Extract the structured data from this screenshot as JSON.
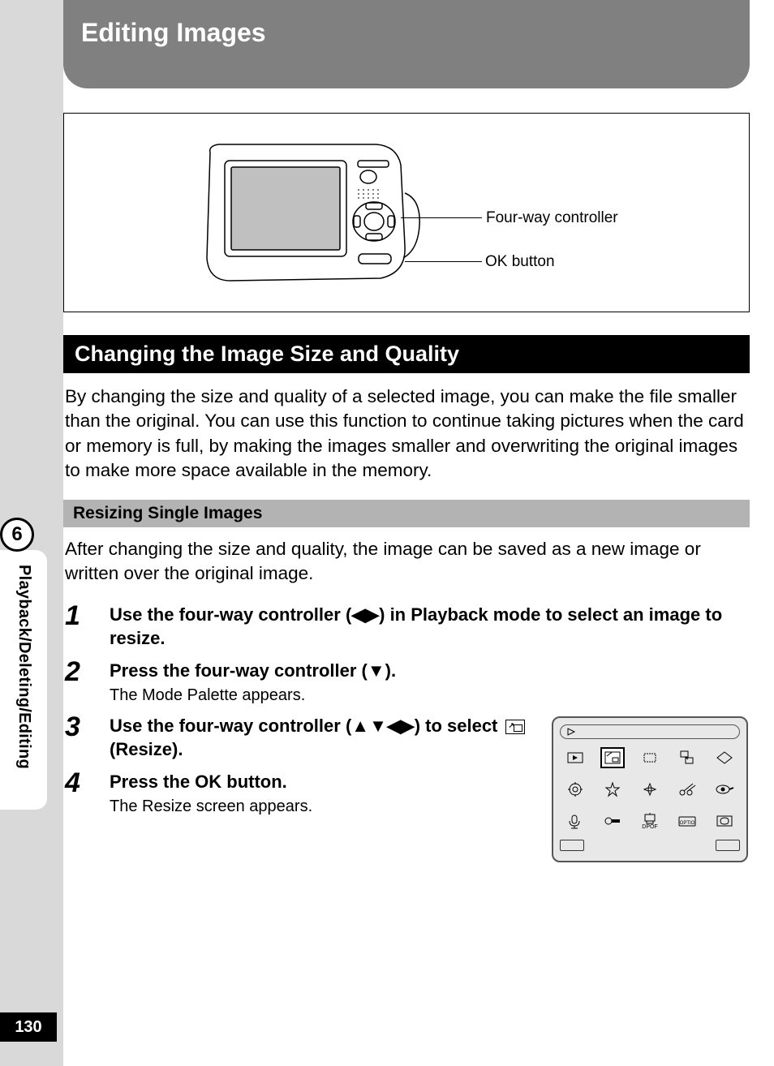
{
  "chapter_title": "Editing Images",
  "diagram": {
    "callout_fourway": "Four-way controller",
    "callout_ok": "OK button"
  },
  "section_heading": "Changing the Image Size and Quality",
  "intro_paragraph": "By changing the size and quality of a selected image, you can make the file smaller than the original. You can use this function to continue taking pictures when the card or memory is full, by making the images smaller and overwriting the original images to make more space available in the memory.",
  "sub_heading": "Resizing Single Images",
  "sub_intro": "After changing the size and quality, the image can be saved as a new image or written over the original image.",
  "steps": {
    "s1": {
      "num": "1",
      "title_a": "Use the four-way controller (",
      "title_b": ") in Playback mode to select an image to resize."
    },
    "s2": {
      "num": "2",
      "title_a": "Press the four-way controller (",
      "title_b": ").",
      "desc": "The Mode Palette appears."
    },
    "s3": {
      "num": "3",
      "title_a": "Use the four-way controller (",
      "title_b": ") to select ",
      "title_c": " (Resize)."
    },
    "s4": {
      "num": "4",
      "title": "Press the OK button.",
      "desc": "The Resize screen appears."
    }
  },
  "palette": {
    "dpof_label": "DPOF"
  },
  "side": {
    "chapter_num": "6",
    "tab_label": "Playback/Deleting/Editing",
    "page_num": "130"
  }
}
